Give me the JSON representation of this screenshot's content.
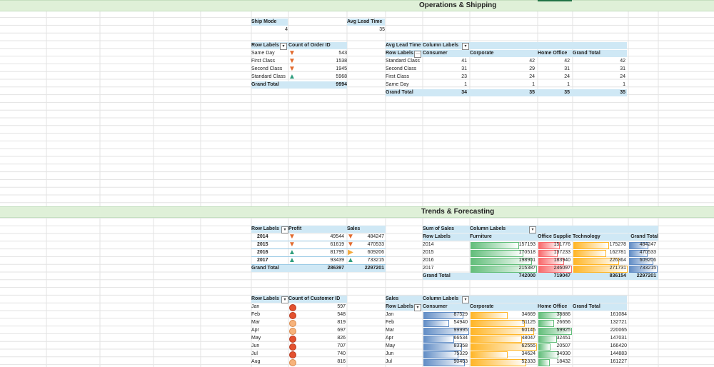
{
  "colors": {
    "green_bar": "#63be7b",
    "red_bar": "#f8696b",
    "orange_bar": "#ffb628",
    "blue_bar": "#638ec6",
    "banner": "#dff0d8",
    "header": "#cfe8f5",
    "arrow_red": "#e26b2f",
    "arrow_green": "#2f9e7e",
    "arrow_orange": "#f2a83b",
    "circ_red": "#e3512f",
    "circ_orange": "#f7b37b"
  },
  "ops": {
    "title": "Operations & Shipping",
    "ship_mode": {
      "label": "Ship Mode",
      "value": "4"
    },
    "avg_lead": {
      "label": "Avg Lead Time",
      "value": "35"
    },
    "orders": {
      "h1": "Row Labels",
      "h2": "Count of Order ID",
      "rows": [
        {
          "label": "Same Day",
          "value": "543",
          "icon": "arrow-down-icon"
        },
        {
          "label": "First Class",
          "value": "1538",
          "icon": "arrow-down-icon"
        },
        {
          "label": "Second Class",
          "value": "1945",
          "icon": "arrow-down-icon"
        },
        {
          "label": "Standard Class",
          "value": "5968",
          "icon": "arrow-up-icon"
        }
      ],
      "total_label": "Grand Total",
      "total": "9994"
    },
    "lead": {
      "title": "Avg Lead Time",
      "col_labels": "Column Labels",
      "row_labels": "Row Labels",
      "cols": [
        "Consumer",
        "Corporate",
        "Home Office",
        "Grand Total"
      ],
      "rows": [
        {
          "label": "Standard Class",
          "v": [
            "41",
            "42",
            "42",
            "42"
          ]
        },
        {
          "label": "Second Class",
          "v": [
            "31",
            "29",
            "31",
            "31"
          ]
        },
        {
          "label": "First Class",
          "v": [
            "23",
            "24",
            "24",
            "24"
          ]
        },
        {
          "label": "Same Day",
          "v": [
            "1",
            "1",
            "1",
            "1"
          ]
        }
      ],
      "total_label": "Grand Total",
      "total": [
        "34",
        "35",
        "35",
        "35"
      ]
    }
  },
  "trends": {
    "title": "Trends & Forecasting",
    "yearly": {
      "h1": "Row Labels",
      "h2": "Profit",
      "h3": "Sales",
      "rows": [
        {
          "label": "2014",
          "profit": "49544",
          "sales": "484247",
          "p_icon": "arrow-down-icon",
          "s_icon": "arrow-down-icon"
        },
        {
          "label": "2015",
          "profit": "61619",
          "sales": "470533",
          "p_icon": "arrow-down-icon",
          "s_icon": "arrow-down-icon"
        },
        {
          "label": "2016",
          "profit": "81795",
          "sales": "609206",
          "p_icon": "arrow-up-icon",
          "s_icon": "arrow-right-icon"
        },
        {
          "label": "2017",
          "profit": "93439",
          "sales": "733215",
          "p_icon": "arrow-up-icon",
          "s_icon": "arrow-up-icon"
        }
      ],
      "total_label": "Grand Total",
      "total_profit": "286397",
      "total_sales": "2297201"
    },
    "sales_cat": {
      "title": "Sum of Sales",
      "col_labels": "Column Labels",
      "row_labels": "Row Labels",
      "cols": [
        "Furniture",
        "Office Supplie",
        "Technology",
        "Grand Total"
      ],
      "rows": [
        {
          "label": "2014",
          "v": [
            "157193",
            "151776",
            "175278",
            "484247"
          ]
        },
        {
          "label": "2015",
          "v": [
            "170518",
            "137233",
            "162781",
            "470533"
          ]
        },
        {
          "label": "2016",
          "v": [
            "198901",
            "183940",
            "226364",
            "609206"
          ]
        },
        {
          "label": "2017",
          "v": [
            "215387",
            "246097",
            "271731",
            "733215"
          ]
        }
      ],
      "total_label": "Grand Total",
      "total": [
        "742000",
        "719047",
        "836154",
        "2297201"
      ]
    },
    "monthly_cust": {
      "h1": "Row Labels",
      "h2": "Count of Customer ID",
      "rows": [
        {
          "label": "Jan",
          "value": "597",
          "level": "red"
        },
        {
          "label": "Feb",
          "value": "548",
          "level": "red"
        },
        {
          "label": "Mar",
          "value": "819",
          "level": "orange"
        },
        {
          "label": "Apr",
          "value": "697",
          "level": "orange"
        },
        {
          "label": "May",
          "value": "826",
          "level": "red"
        },
        {
          "label": "Jun",
          "value": "707",
          "level": "red"
        },
        {
          "label": "Jul",
          "value": "740",
          "level": "red"
        },
        {
          "label": "Aug",
          "value": "816",
          "level": "orange"
        }
      ]
    },
    "monthly_sales": {
      "title": "Sales",
      "col_labels": "Column Labels",
      "row_labels": "Row Labels",
      "cols": [
        "Consumer",
        "Corporate",
        "Home Office",
        "Grand Total"
      ],
      "rows": [
        {
          "label": "Jan",
          "v": [
            "87529",
            "34669",
            "38886",
            "161084"
          ]
        },
        {
          "label": "Feb",
          "v": [
            "54940",
            "51125",
            "26656",
            "132721"
          ]
        },
        {
          "label": "Mar",
          "v": [
            "99995",
            "60145",
            "59925",
            "220065"
          ]
        },
        {
          "label": "Apr",
          "v": [
            "66534",
            "48047",
            "32451",
            "147031"
          ]
        },
        {
          "label": "May",
          "v": [
            "83358",
            "62555",
            "20507",
            "166420"
          ]
        },
        {
          "label": "Jun",
          "v": [
            "75329",
            "34624",
            "34930",
            "144883"
          ]
        },
        {
          "label": "Jul",
          "v": [
            "90463",
            "52333",
            "18432",
            "161227"
          ]
        }
      ]
    }
  }
}
